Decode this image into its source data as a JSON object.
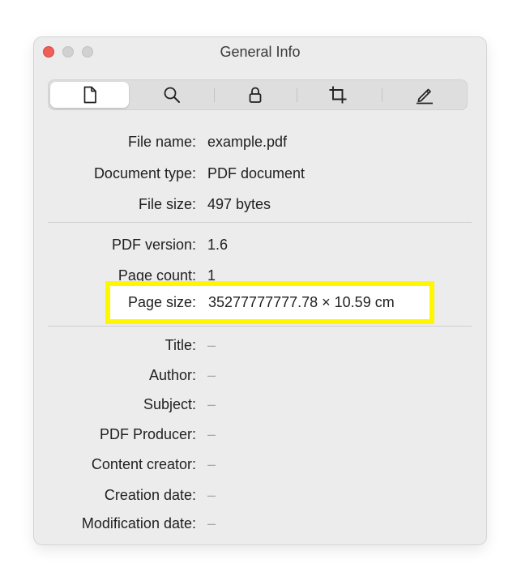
{
  "window": {
    "title": "General Info"
  },
  "toolbar": {
    "segments": [
      {
        "icon": "document-icon",
        "active": true
      },
      {
        "icon": "search-icon",
        "active": false
      },
      {
        "icon": "lock-icon",
        "active": false
      },
      {
        "icon": "crop-icon",
        "active": false
      },
      {
        "icon": "pencil-icon",
        "active": false
      }
    ]
  },
  "file_section": {
    "file_name_label": "File name:",
    "file_name_value": "example.pdf",
    "document_type_label": "Document type:",
    "document_type_value": "PDF document",
    "file_size_label": "File size:",
    "file_size_value": "497 bytes"
  },
  "pdf_section": {
    "pdf_version_label": "PDF version:",
    "pdf_version_value": "1.6",
    "page_count_label": "Page count:",
    "page_count_value": "1",
    "page_size_label": "Page size:",
    "page_size_value": "35277777777.78 × 10.59 cm"
  },
  "metadata_section": {
    "title_label": "Title:",
    "title_value": "–",
    "author_label": "Author:",
    "author_value": "–",
    "subject_label": "Subject:",
    "subject_value": "–",
    "producer_label": "PDF Producer:",
    "producer_value": "–",
    "creator_label": "Content creator:",
    "creator_value": "–",
    "creation_date_label": "Creation date:",
    "creation_date_value": "–",
    "modification_date_label": "Modification date:",
    "modification_date_value": "–"
  },
  "colors": {
    "highlight": "#fff700",
    "close_button": "#ee5f58",
    "window_background": "#ececec"
  }
}
